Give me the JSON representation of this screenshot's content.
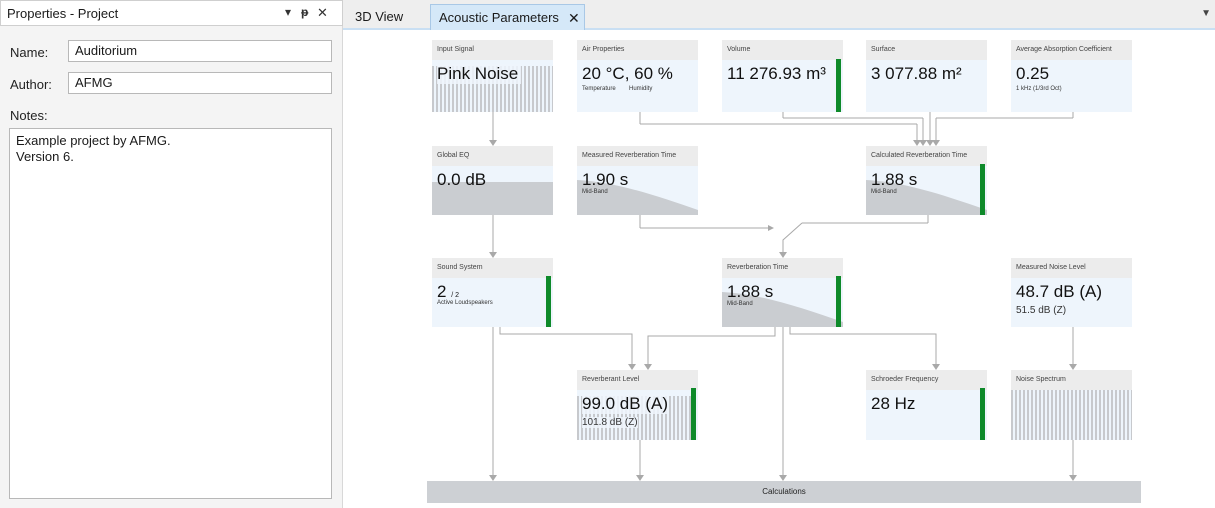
{
  "panel": {
    "title": "Properties - Project",
    "dropdown_icon": "▾",
    "pin_icon": "ᵽ",
    "close_icon": "✕",
    "name_label": "Name:",
    "name_value": "Auditorium",
    "author_label": "Author:",
    "author_value": "AFMG",
    "notes_label": "Notes:",
    "notes_value": "Example project by AFMG.\nVersion 6."
  },
  "tabs": {
    "view3d": "3D View",
    "acoustic": "Acoustic Parameters",
    "close_icon": "✕",
    "menu_icon": "▼"
  },
  "cards": {
    "input_signal": {
      "title": "Input Signal",
      "value": "Pink Noise"
    },
    "air": {
      "title": "Air Properties",
      "value": "20 °C,  60 %",
      "sub1": "Temperature",
      "sub2": "Humidity"
    },
    "volume": {
      "title": "Volume",
      "value": "11 276.93 m³"
    },
    "surface": {
      "title": "Surface",
      "value": "3 077.88 m²"
    },
    "absorption": {
      "title": "Average Absorption Coefficient",
      "value": "0.25",
      "sub": "1 kHz (1/3rd Oct)"
    },
    "global_eq": {
      "title": "Global EQ",
      "value": "0.0  dB"
    },
    "measured_rt": {
      "title": "Measured Reverberation Time",
      "value": "1.90  s",
      "sub": "Mid-Band"
    },
    "calculated_rt": {
      "title": "Calculated Reverberation Time",
      "value": "1.88  s",
      "sub": "Mid-Band"
    },
    "sound_system": {
      "title": "Sound System",
      "value": "2",
      "value_small": "/ 2",
      "sub": "Active Loudspeakers"
    },
    "rt": {
      "title": "Reverberation Time",
      "value": "1.88  s",
      "sub": "Mid-Band"
    },
    "measured_noise": {
      "title": "Measured Noise Level",
      "value": "48.7  dB (A)",
      "value2": "51.5  dB (Z)"
    },
    "reverberant_level": {
      "title": "Reverberant Level",
      "value": "99.0  dB (A)",
      "value2": "101.8  dB (Z)"
    },
    "schroeder": {
      "title": "Schroeder Frequency",
      "value": "28 Hz"
    },
    "noise_spectrum": {
      "title": "Noise Spectrum"
    }
  },
  "calculations": "Calculations",
  "colors": {
    "accent_green": "#0e8a2a",
    "card_bg": "#eef5fc",
    "tab_active": "#d5e8f8"
  }
}
